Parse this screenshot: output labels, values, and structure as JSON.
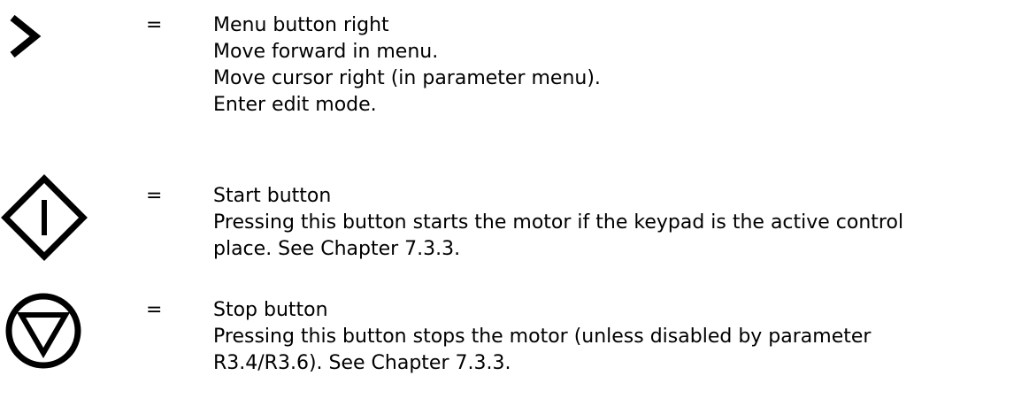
{
  "entries": [
    {
      "icon": "chevron-right-icon",
      "equals": "=",
      "title": "Menu button right",
      "lines": [
        "Move forward in menu.",
        "Move cursor right (in parameter menu).",
        "Enter edit mode."
      ]
    },
    {
      "icon": "start-button-icon",
      "equals": "=",
      "title": "Start button",
      "lines": [
        "Pressing this button starts the motor if the keypad is the active control",
        "place. See Chapter 7.3.3."
      ]
    },
    {
      "icon": "stop-button-icon",
      "equals": "=",
      "title": "Stop button",
      "lines": [
        "Pressing this button stops the motor (unless disabled by parameter",
        "R3.4/R3.6). See Chapter 7.3.3."
      ]
    }
  ]
}
